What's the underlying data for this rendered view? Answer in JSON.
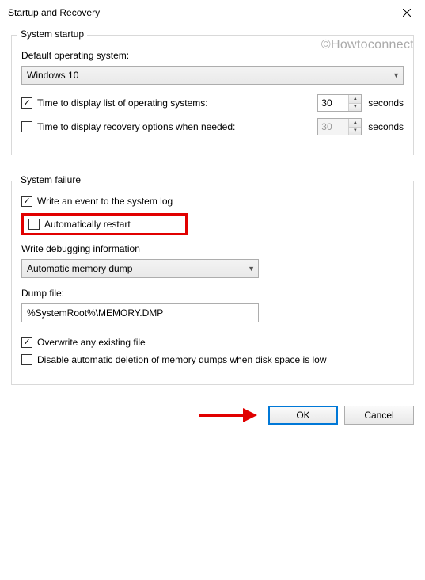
{
  "window": {
    "title": "Startup and Recovery"
  },
  "watermark": "©Howtoconnect",
  "startup": {
    "legend": "System startup",
    "defaultOsLabel": "Default operating system:",
    "defaultOsValue": "Windows 10",
    "timeDisplayList": {
      "label": "Time to display list of operating systems:",
      "checked": true,
      "value": "30",
      "unit": "seconds"
    },
    "timeRecovery": {
      "label": "Time to display recovery options when needed:",
      "checked": false,
      "value": "30",
      "unit": "seconds"
    }
  },
  "failure": {
    "legend": "System failure",
    "writeEvent": {
      "label": "Write an event to the system log",
      "checked": true
    },
    "autoRestart": {
      "label": "Automatically restart",
      "checked": false
    },
    "debugLabel": "Write debugging information",
    "debugValue": "Automatic memory dump",
    "dumpLabel": "Dump file:",
    "dumpValue": "%SystemRoot%\\MEMORY.DMP",
    "overwrite": {
      "label": "Overwrite any existing file",
      "checked": true
    },
    "disableDelete": {
      "label": "Disable automatic deletion of memory dumps when disk space is low",
      "checked": false
    }
  },
  "buttons": {
    "ok": "OK",
    "cancel": "Cancel"
  }
}
